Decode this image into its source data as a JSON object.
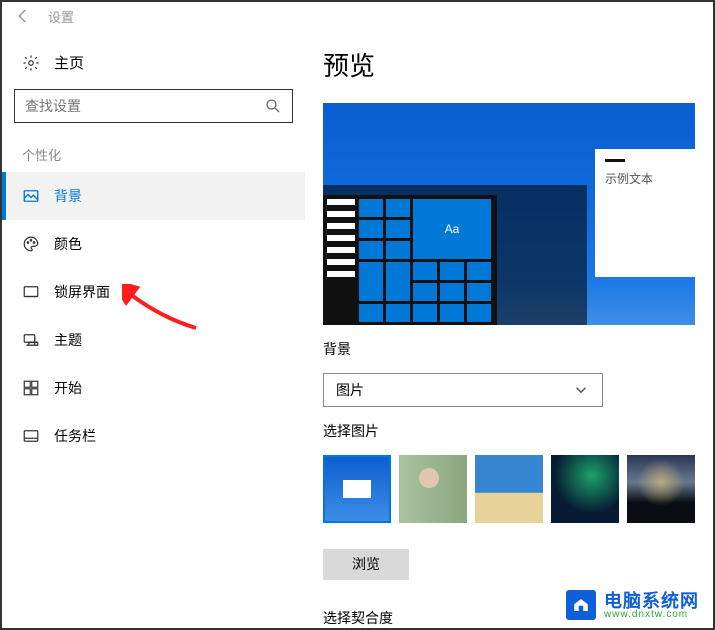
{
  "titlebar": {
    "title": "设置"
  },
  "sidebar": {
    "home": "主页",
    "search_placeholder": "查找设置",
    "category": "个性化",
    "items": [
      {
        "key": "background",
        "label": "背景",
        "active": true
      },
      {
        "key": "colors",
        "label": "颜色"
      },
      {
        "key": "lockscreen",
        "label": "锁屏界面"
      },
      {
        "key": "themes",
        "label": "主题"
      },
      {
        "key": "start",
        "label": "开始"
      },
      {
        "key": "taskbar",
        "label": "任务栏"
      }
    ]
  },
  "main": {
    "preview_heading": "预览",
    "sample_text": "示例文本",
    "tile_text": "Aa",
    "background_label": "背景",
    "background_value": "图片",
    "choose_label": "选择图片",
    "browse": "浏览",
    "fit_label_partial": "选择契合度"
  },
  "watermark": {
    "cn": "电脑系统网",
    "url": "www.dnxtw.com"
  }
}
